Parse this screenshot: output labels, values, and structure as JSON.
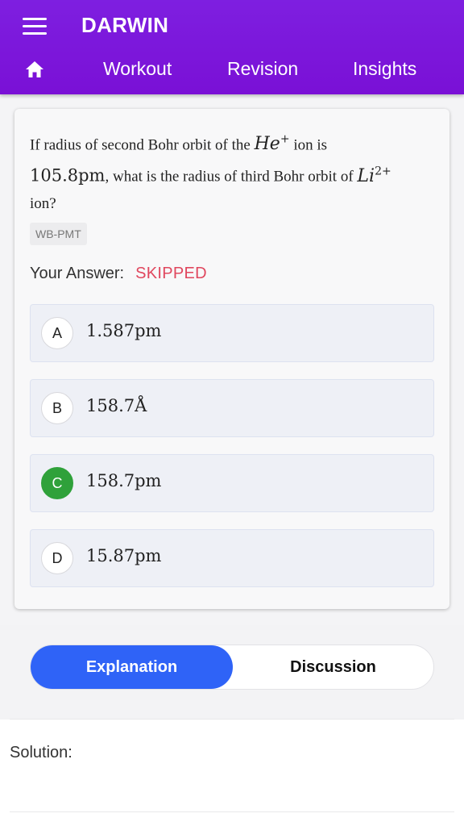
{
  "app": {
    "title": "DARWIN"
  },
  "nav": {
    "items": [
      "Workout",
      "Revision",
      "Insights"
    ]
  },
  "question": {
    "text_1": "If radius of second Bohr orbit of the ",
    "ion1_base": "He",
    "ion1_sup": "+",
    "text_2": " ion is ",
    "value": "105.8pm",
    "text_3": ", what is the radius of third Bohr orbit of ",
    "ion2_base": "Li",
    "ion2_sup": "2+",
    "text_4": " ion?",
    "tag": "WB-PMT"
  },
  "answer": {
    "label": "Your Answer:",
    "value": "SKIPPED",
    "value_color": "#e0475e"
  },
  "options": [
    {
      "letter": "A",
      "text": "1.587pm",
      "correct": false
    },
    {
      "letter": "B",
      "text": "158.7Å",
      "correct": false
    },
    {
      "letter": "C",
      "text": "158.7pm",
      "correct": true
    },
    {
      "letter": "D",
      "text": "15.87pm",
      "correct": false
    }
  ],
  "tabs": {
    "active": "Explanation",
    "inactive": "Discussion"
  },
  "solution": {
    "label": "Solution:"
  },
  "colors": {
    "appbar": "#7a10d6",
    "accent": "#2f63f7",
    "correct": "#2fa13a"
  }
}
